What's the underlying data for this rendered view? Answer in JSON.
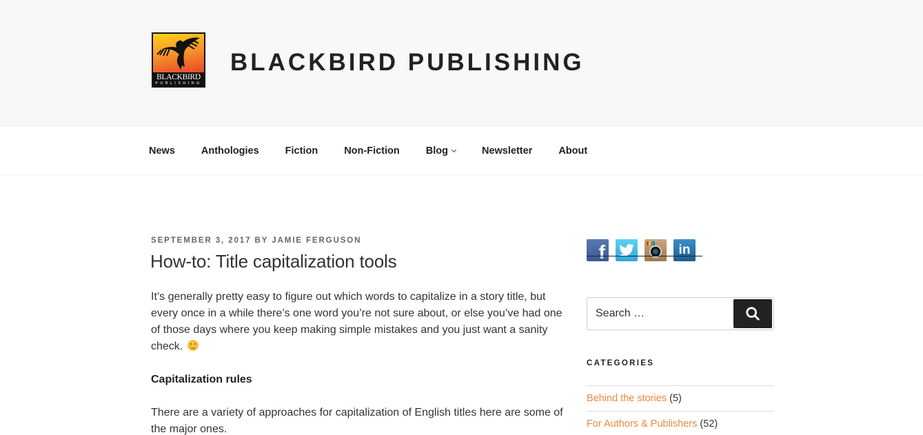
{
  "header": {
    "logo": {
      "line1": "BLACKBIRD",
      "line2": "PUBLISHING"
    },
    "site_title": "BLACKBIRD PUBLISHING"
  },
  "nav": {
    "items": [
      {
        "label": "News"
      },
      {
        "label": "Anthologies"
      },
      {
        "label": "Fiction"
      },
      {
        "label": "Non-Fiction"
      },
      {
        "label": "Blog",
        "has_submenu": true
      },
      {
        "label": "Newsletter"
      },
      {
        "label": "About"
      }
    ]
  },
  "post": {
    "date": "September 3, 2017",
    "by": "by",
    "author": "Jamie Ferguson",
    "title": "How-to: Title capitalization tools",
    "paragraphs": [
      "It’s generally pretty easy to figure out which words to capitalize in a story title, but every once in a while there’s one word you’re not sure about, or else you’ve had one of those days where you keep making simple mistakes and you just want a sanity check.",
      "Capitalization rules",
      "There are a variety of approaches for capitalization of English titles here are some of the major ones."
    ],
    "emoji": "smiley-face"
  },
  "sidebar": {
    "social": [
      {
        "name": "facebook",
        "glyph": "f"
      },
      {
        "name": "twitter",
        "glyph": ""
      },
      {
        "name": "instagram",
        "glyph": ""
      },
      {
        "name": "linkedin",
        "glyph": "in"
      }
    ],
    "search": {
      "placeholder": "Search …",
      "value": ""
    },
    "categories_title": "CATEGORIES",
    "categories": [
      {
        "label": "Behind the stories",
        "count": "(5)"
      },
      {
        "label": "For Authors & Publishers",
        "count": "(52)"
      }
    ],
    "link_color": "#f0883e"
  }
}
